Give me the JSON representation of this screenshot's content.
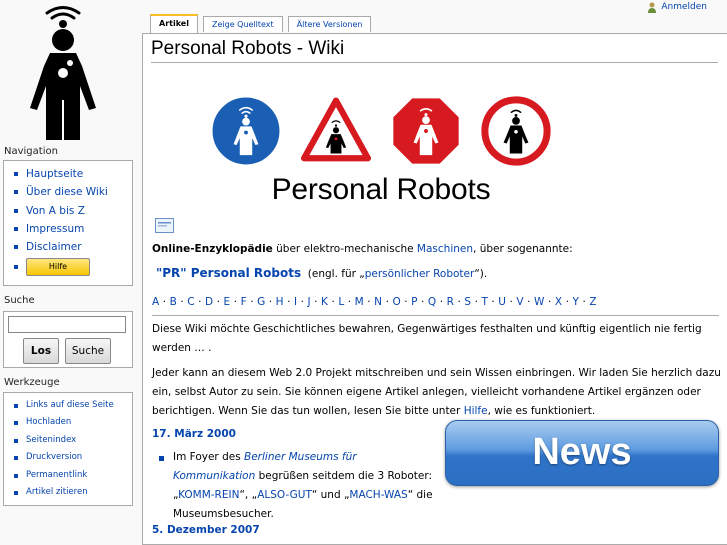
{
  "personal": {
    "login_label": "Anmelden"
  },
  "tabs": [
    {
      "label": "Artikel",
      "selected": true
    },
    {
      "label": "Zeige Quelltext",
      "selected": false
    },
    {
      "label": "Ältere Versionen",
      "selected": false
    }
  ],
  "page": {
    "title": "Personal Robots - Wiki"
  },
  "banner": {
    "text": "Personal Robots"
  },
  "intro": {
    "bold": "Online-Enzyklopädie",
    "text1": " über elektro-mechanische ",
    "link_maschinen": "Maschinen",
    "text2": ", über sogenannte:",
    "pr_title": "\"PR\" Personal Robots",
    "pr_text1": "(engl. für „",
    "pr_link": "persönlicher Roboter",
    "pr_text2": "“)."
  },
  "alphabet": [
    "A",
    "B",
    "C",
    "D",
    "E",
    "F",
    "G",
    "H",
    "I",
    "J",
    "K",
    "L",
    "M",
    "N",
    "O",
    "P",
    "Q",
    "R",
    "S",
    "T",
    "U",
    "V",
    "W",
    "X",
    "Y",
    "Z"
  ],
  "paragraphs": {
    "p1": "Diese Wiki möchte Geschichtliches bewahren, Gegenwärtiges festhalten und künftig eigentlich nie fertig werden … .",
    "p2_a": "Jeder kann an diesem Web 2.0 Projekt mitschreiben und sein Wissen einbringen. Wir laden Sie herzlich dazu ein, selbst Autor zu sein. Sie können eigene Artikel anlegen, vielleicht vorhandene Artikel ergänzen oder berichtigen. Wenn Sie das tun wollen, lesen Sie bitte unter ",
    "p2_link": "Hilfe",
    "p2_b": ", wie es funktioniert."
  },
  "news": {
    "button_label": "News",
    "date1": "17. März 2000",
    "item1": {
      "t1": "Im Foyer des ",
      "link1": "Berliner Museums für Kommunikation",
      "t2": " begrüßen seitdem die 3 Roboter: „",
      "link2": "KOMM-REIN",
      "t3": "“, „",
      "link3": "ALSO-GUT",
      "t4": "“ und „",
      "link4": "MACH-WAS",
      "t5": "“ die Museumsbesucher."
    },
    "date2": "5. Dezember 2007"
  },
  "sidebar": {
    "navigation_title": "Navigation",
    "nav_items": [
      "Hauptseite",
      "Über diese Wiki",
      "Von A bis Z",
      "Impressum",
      "Disclaimer"
    ],
    "hilfe_button": "Hilfe",
    "search_title": "Suche",
    "search_value": "",
    "search_go": "Los",
    "search_full": "Suche",
    "tools_title": "Werkzeuge",
    "tools_items": [
      "Links auf diese Seite",
      "Hochladen",
      "Seitenindex",
      "Druckversion",
      "Permanentlink",
      "Artikel zitieren"
    ]
  },
  "colors": {
    "link": "#0645ad",
    "tab_accent": "#fabd23",
    "news_blue": "#2f74c9",
    "sign_red": "#d71920",
    "sign_blue": "#1a5fb4"
  },
  "icons": [
    "user-icon",
    "robot-logo",
    "robot-blue-sign",
    "robot-warning-sign",
    "robot-stop-sign",
    "robot-prohibition-sign",
    "image-icon"
  ]
}
